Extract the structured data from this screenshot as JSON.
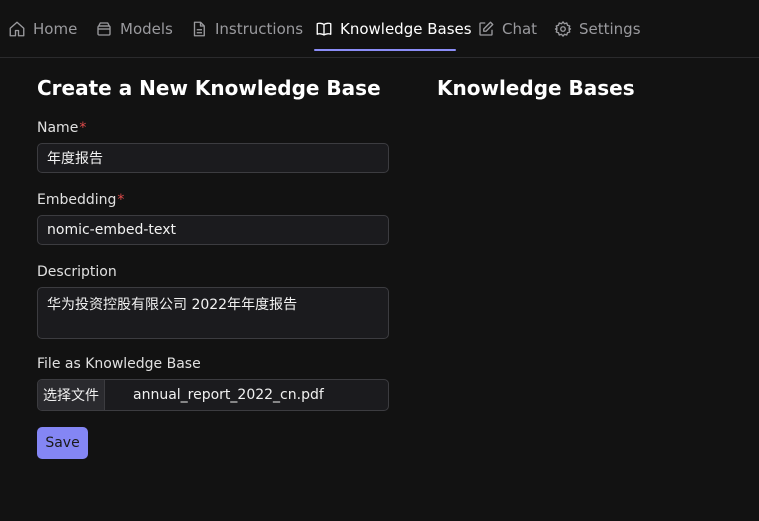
{
  "nav": {
    "tabs": [
      {
        "label": "Home",
        "icon": "home-icon"
      },
      {
        "label": "Models",
        "icon": "box-icon"
      },
      {
        "label": "Instructions",
        "icon": "document-icon"
      },
      {
        "label": "Knowledge Bases",
        "icon": "book-icon"
      },
      {
        "label": "Chat",
        "icon": "edit-icon"
      },
      {
        "label": "Settings",
        "icon": "gear-icon"
      }
    ],
    "active_tab": "Knowledge Bases",
    "accent_color": "#8b8df7"
  },
  "form": {
    "title": "Create a New Knowledge Base",
    "name_label": "Name",
    "name_value": "年度报告",
    "embedding_label": "Embedding",
    "embedding_value": "nomic-embed-text",
    "required_marker": "*",
    "description_label": "Description",
    "description_value": "华为投资控股有限公司 2022年年度报告",
    "file_label": "File as Knowledge Base",
    "file_button_label": "选择文件",
    "file_name": "annual_report_2022_cn.pdf",
    "save_label": "Save"
  },
  "list": {
    "title": "Knowledge Bases"
  }
}
